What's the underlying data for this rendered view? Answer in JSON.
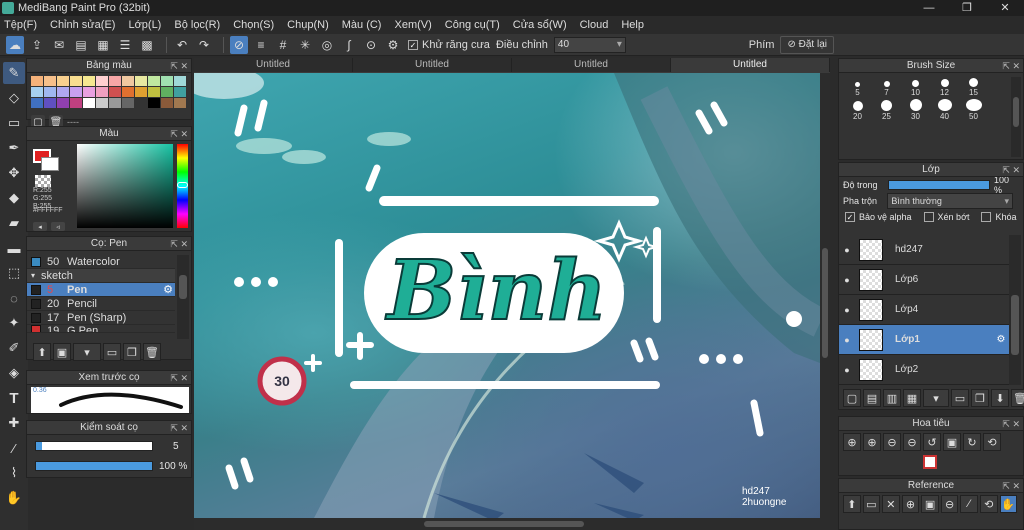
{
  "window": {
    "title": "MediBang Paint Pro (32bit)",
    "controls": [
      "—",
      "❐",
      "✕"
    ]
  },
  "menu": [
    "Tệp(F)",
    "Chỉnh sửa(E)",
    "Lớp(L)",
    "Bộ lọc(R)",
    "Chọn(S)",
    "Chụp(N)",
    "Màu (C)",
    "Xem(V)",
    "Công cụ(T)",
    "Cửa sổ(W)",
    "Cloud",
    "Help"
  ],
  "toolbar": {
    "antialias_label": "Khử răng cưa",
    "adjust_label": "Điều chỉnh",
    "adjust_value": "40",
    "key_label": "Phím",
    "reset_label": "Đặt lại"
  },
  "doc_tabs": [
    "Untitled",
    "Untitled",
    "Untitled",
    "Untitled"
  ],
  "palette": {
    "title": "Bảng màu",
    "footer_label": "----",
    "colors": [
      "#f5b27a",
      "#f7c08a",
      "#f8d08e",
      "#f9de90",
      "#f5e890",
      "#ffd0d0",
      "#f7a6a6",
      "#f0c8a0",
      "#e8e8a0",
      "#c0e8a0",
      "#a0e0b0",
      "#a0d8d8",
      "#a6d0f0",
      "#a0b8f0",
      "#b0a8f0",
      "#c8a0f0",
      "#e8a0e0",
      "#f0a0c0",
      "#d05050",
      "#e07030",
      "#e0a030",
      "#c0c040",
      "#60b060",
      "#40a0a0",
      "#4070c0",
      "#6050c0",
      "#9040b0",
      "#c04080",
      "#ffffff",
      "#cccccc",
      "#999999",
      "#666666",
      "#333333",
      "#000000",
      "#8a5a3a",
      "#a07850"
    ]
  },
  "color_panel": {
    "title": "Màu",
    "rgb_text": "R:255\nG:255\nB:255",
    "hex": "#FFFFFF"
  },
  "brush_panel": {
    "title": "Cọ: Pen",
    "items": [
      {
        "num": "50",
        "name": "Watercolor",
        "color": "#3a8ac0",
        "active": false
      },
      {
        "num": "",
        "name": "sketch",
        "color": "",
        "group": true
      },
      {
        "num": "5",
        "name": "Pen",
        "color": "#222222",
        "active": true
      },
      {
        "num": "20",
        "name": "Pencil",
        "color": "#222222",
        "active": false
      },
      {
        "num": "17",
        "name": "Pen (Sharp)",
        "color": "#222222",
        "active": false
      },
      {
        "num": "19",
        "name": "G Pen",
        "color": "#d03030",
        "active": false
      }
    ]
  },
  "preview_panel": {
    "title": "Xem trước cọ",
    "size_text": "0.36"
  },
  "brush_control": {
    "title": "Kiểm soát cọ",
    "size_value": "5",
    "opacity_value": "100 %",
    "size_fraction": 0.05,
    "opacity_fraction": 1.0
  },
  "brush_size": {
    "title": "Brush Size",
    "sizes": [
      "5",
      "7",
      "10",
      "12",
      "15",
      "20",
      "25",
      "30",
      "40",
      "50"
    ]
  },
  "layer_panel": {
    "title": "Lớp",
    "opacity_label": "Độ trong",
    "opacity_value": "100 %",
    "opacity_fraction": 1.0,
    "blend_label": "Pha trộn",
    "blend_value": "Bình thường",
    "protect_alpha": "Bảo vệ alpha",
    "clip": "Xén bớt",
    "lock": "Khóa",
    "layers": [
      {
        "name": "hd247",
        "active": false
      },
      {
        "name": "Lớp6",
        "active": false
      },
      {
        "name": "Lớp4",
        "active": false
      },
      {
        "name": "Lớp1",
        "active": true
      },
      {
        "name": "Lớp2",
        "active": false
      }
    ]
  },
  "navigator": {
    "title": "Hoa tiêu"
  },
  "reference": {
    "title": "Reference"
  },
  "artwork": {
    "main_text": "Bình",
    "watermark_line1": "hd247",
    "watermark_line2": "2huongne",
    "sign_number": "30"
  }
}
